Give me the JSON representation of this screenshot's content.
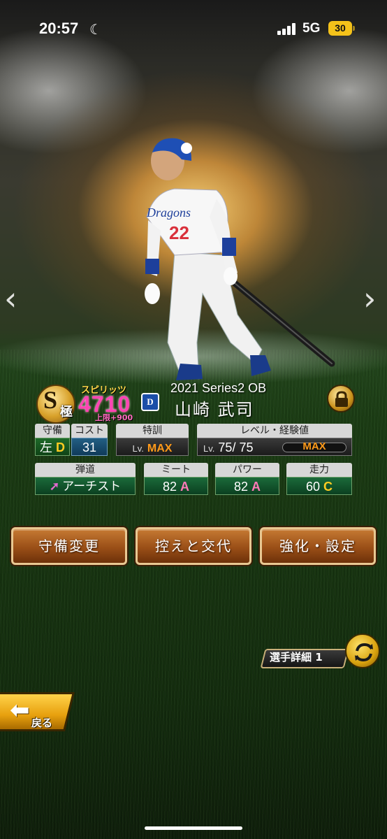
{
  "status_bar": {
    "time": "20:57",
    "network": "5G",
    "battery": "30",
    "moon_icon": "moon-icon",
    "signal_icon": "signal-bars-icon"
  },
  "nav": {
    "prev": "‹",
    "next": "›"
  },
  "card": {
    "rank_letter": "S",
    "rank_kanji": "極",
    "spirits_label": "スピリッツ",
    "spirits_value": "4710",
    "spirits_limit": "上限+900",
    "team_logo": "D",
    "series": "2021 Series2 OB",
    "player_name": "山崎 武司",
    "number": "22",
    "team_name": "Dragons"
  },
  "stats": {
    "defense": {
      "label": "守備",
      "position": "左",
      "grade": "D"
    },
    "cost": {
      "label": "コスト",
      "value": "31"
    },
    "training": {
      "label": "特訓",
      "lv": "Lv.",
      "value": "MAX"
    },
    "level": {
      "label": "レベル・経験値",
      "lv": "Lv.",
      "current": "75",
      "sep": "/",
      "max": "75",
      "exp_label": "MAX"
    },
    "trajectory": {
      "label": "弾道",
      "value": "アーチスト"
    },
    "meet": {
      "label": "ミート",
      "value": "82",
      "grade": "A"
    },
    "power": {
      "label": "パワー",
      "value": "82",
      "grade": "A"
    },
    "speed": {
      "label": "走力",
      "value": "60",
      "grade": "C"
    }
  },
  "buttons": {
    "defense_change": "守備変更",
    "bench_swap": "控えと交代",
    "enhance": "強化・設定"
  },
  "detail": {
    "label": "選手詳細 1"
  },
  "back": {
    "label": "戻る"
  },
  "colors": {
    "button_brown": "#9a4f17",
    "gold": "#d8a12a",
    "spirits_pink": "#ff44b4",
    "max_orange": "#ff9a1a"
  }
}
